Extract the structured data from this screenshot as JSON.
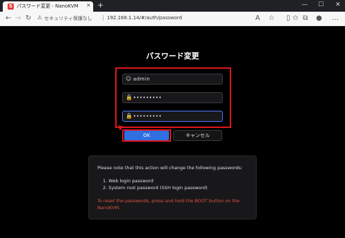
{
  "browser": {
    "tab_title": "パスワード変更 - NanoKVM",
    "favicon_letter": "S",
    "tab_close": "×",
    "new_tab": "+",
    "security_label": "セキュリティ保護なし",
    "url": "192.168.1.14/#/auth/password"
  },
  "page": {
    "title": "パスワード変更",
    "username_value": "admin",
    "password_value": "•••••••••",
    "confirm_password_value": "•••••••••",
    "ok_label": "OK",
    "cancel_label": "キャンセル"
  },
  "info": {
    "intro": "Please note that this action will change the following passwords:",
    "items": [
      "1. Web login password",
      "2. System root password (SSH login password)"
    ],
    "warning": "To reset the passwords, press and hold the BOOT button on the NanoKVM."
  },
  "colors": {
    "accent": "#2f6fe0",
    "highlight": "#e0161e",
    "warning": "#e5533c"
  }
}
